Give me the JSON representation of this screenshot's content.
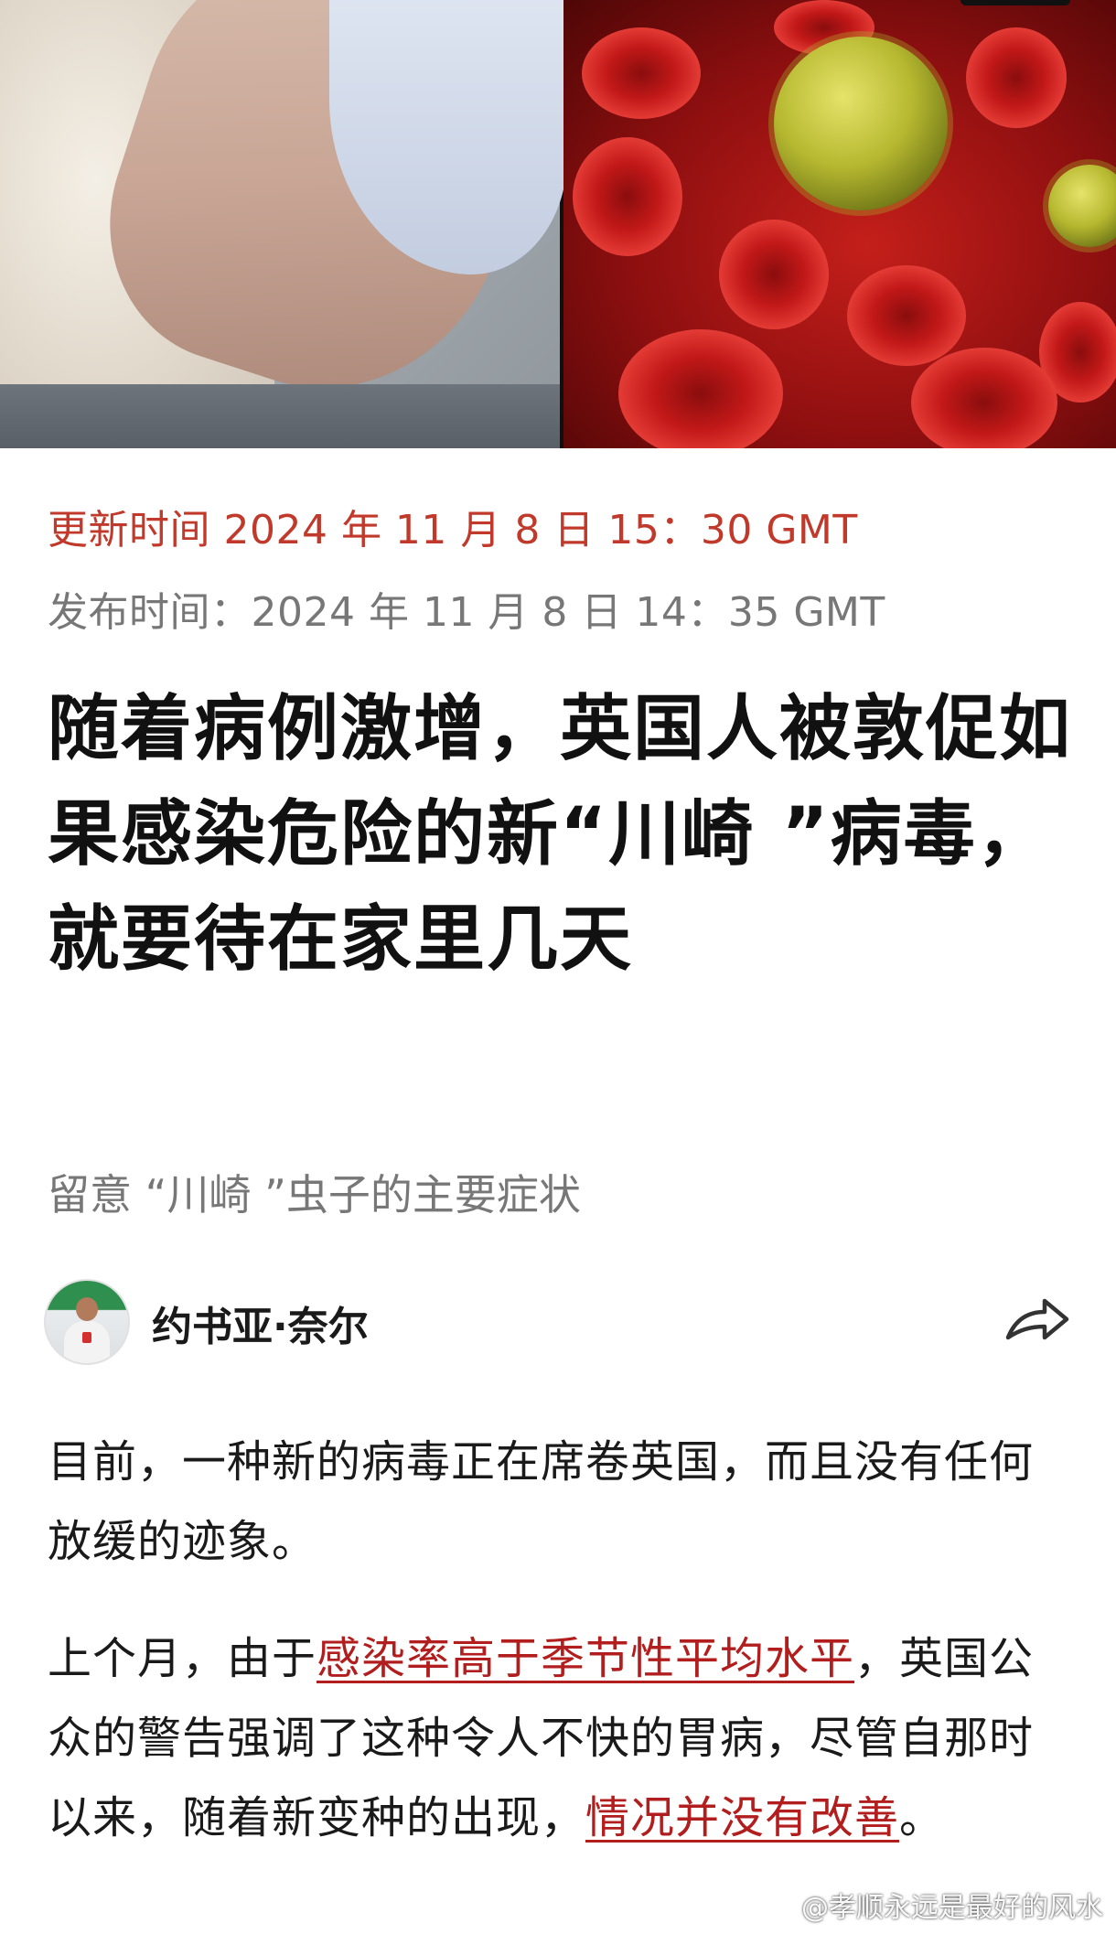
{
  "article": {
    "update_time": "更新时间 2024 年 11 月 8 日 15：30 GMT",
    "publish_time": "发布时间：2024 年 11 月 8 日 14：35 GMT",
    "headline": "随着病例激增，英国人被敦促如果感染危险的新“川崎 ”病毒，就要待在家里几天",
    "subtitle": "留意 “川崎 ”虫子的主要症状",
    "author": {
      "name": "约书亚·奈尔",
      "avatar_icon": "author-avatar"
    },
    "share_icon": "share-arrow-icon",
    "paragraph1": "目前，一种新的病毒正在席卷英国，而且没有任何放缓的迹象。",
    "paragraph2": {
      "part1": "上个月，由于",
      "link1": "感染率高于季节性平均水平",
      "part2": "，英国公众的警告强调了这种令人不快的胃病，尽管自那时以来，随着新变种的出现，",
      "link2": "情况并没有改善",
      "part3": "。"
    }
  },
  "watermark": {
    "text": "@孝顺永远是最好的风水",
    "icon": "weibo-icon"
  },
  "colors": {
    "accent_red": "#c0392b",
    "link_red": "#b21d1d",
    "muted_gray": "#777777"
  }
}
